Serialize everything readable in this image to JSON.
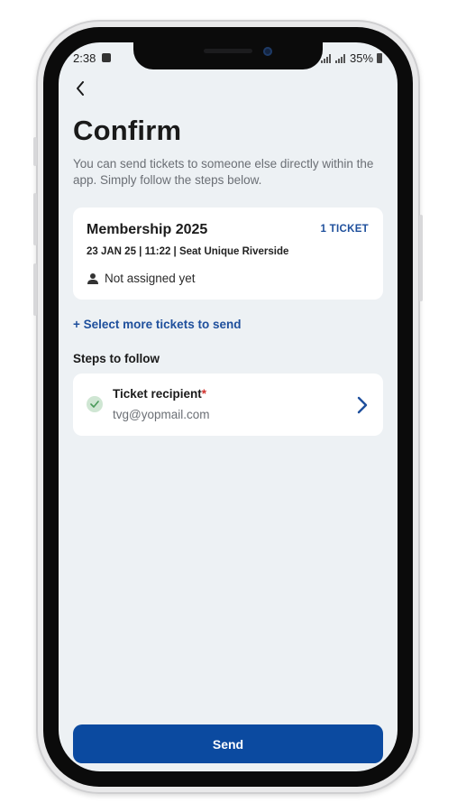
{
  "status_bar": {
    "time": "2:38",
    "battery": "35%"
  },
  "header": {
    "title": "Confirm",
    "subtitle": "You can send tickets to someone else directly within the app. Simply follow the steps below."
  },
  "ticket": {
    "name": "Membership 2025",
    "count_label": "1 TICKET",
    "details": "23 JAN 25 | 11:22 | Seat Unique Riverside",
    "assignment": "Not assigned yet"
  },
  "select_more_label": "+ Select more tickets to send",
  "steps": {
    "title": "Steps to follow",
    "items": [
      {
        "label": "Ticket recipient",
        "required_mark": "*",
        "value": "tvg@yopmail.com",
        "completed": true
      }
    ]
  },
  "send_label": "Send",
  "colors": {
    "accent": "#1e4f9c",
    "button": "#0b4aa0",
    "background": "#edf1f4",
    "check_bg": "#cfe6d3",
    "required": "#d0312d"
  },
  "icons": {
    "back": "back-arrow-icon",
    "person": "person-icon",
    "check": "check-icon",
    "chevron": "chevron-right-icon"
  }
}
